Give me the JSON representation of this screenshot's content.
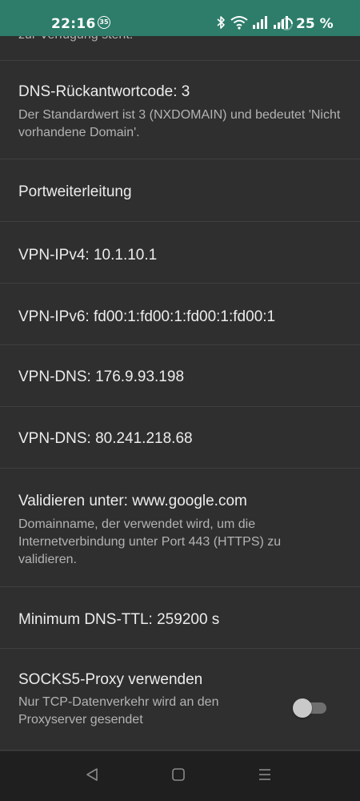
{
  "status_bar": {
    "time": "22:16",
    "notification_badge": "35",
    "battery_text": "25 %",
    "icons": [
      "bluetooth-icon",
      "wifi-icon",
      "signal-icon",
      "signal-icon",
      "battery-ring-icon"
    ]
  },
  "settings": {
    "partial_top_summary": "zur Verfügung steht.",
    "dns_response_code": {
      "title": "DNS-Rückantwortcode: 3",
      "summary": "Der Standardwert ist 3 (NXDOMAIN) und bedeutet 'Nicht vorhandene Domain'."
    },
    "port_forwarding": {
      "title": "Portweiterleitung"
    },
    "vpn_ipv4": {
      "title": "VPN-IPv4: 10.1.10.1"
    },
    "vpn_ipv6": {
      "title": "VPN-IPv6: fd00:1:fd00:1:fd00:1:fd00:1"
    },
    "vpn_dns_1": {
      "title": "VPN-DNS: 176.9.93.198"
    },
    "vpn_dns_2": {
      "title": "VPN-DNS: 80.241.218.68"
    },
    "validate_at": {
      "title": "Validieren unter: www.google.com",
      "summary": "Domainname, der verwendet wird, um die Internetverbindung unter Port 443 (HTTPS) zu validieren."
    },
    "min_dns_ttl": {
      "title": "Minimum DNS-TTL: 259200 s"
    },
    "socks5_proxy": {
      "title": "SOCKS5-Proxy verwenden",
      "summary": "Nur TCP-Datenverkehr wird an den Proxyserver gesendet",
      "enabled": false
    }
  },
  "nav_bar": {
    "buttons": [
      "back-icon",
      "home-icon",
      "recents-icon"
    ]
  },
  "colors": {
    "status_bar_bg": "#2e7d6b",
    "background": "#2f2f2f",
    "divider": "#3f3f3f",
    "title_text": "#ececec",
    "summary_text": "#b3b3b3",
    "nav_bar_bg": "#1f1f1f"
  }
}
